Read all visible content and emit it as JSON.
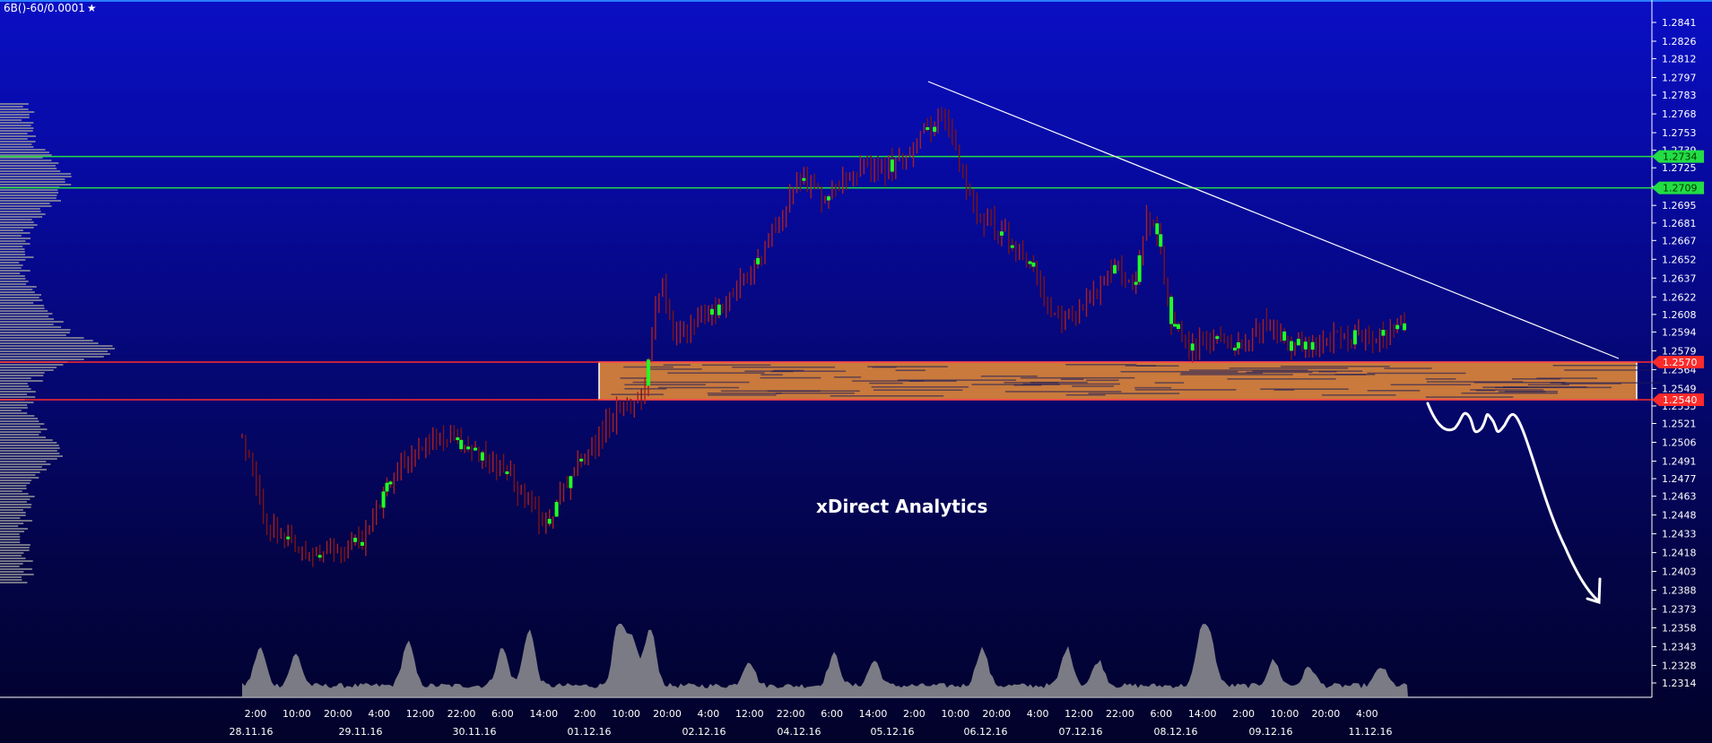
{
  "symbol": "6B()-60/0.0001",
  "symbol_icon": "star-icon",
  "watermark": "xDirect Analytics",
  "colors": {
    "background_top": "#0a0fc4",
    "background_bottom": "#02022a",
    "bar_up": "#22ff22",
    "bar_down": "#8b1a1a",
    "resistance_line": "#22dd44",
    "support_line": "#ff2a2a",
    "zone_fill": "#c97a3c",
    "trendline": "#ffffff",
    "axis_text": "#ffffff"
  },
  "chart_data": {
    "type": "candlestick",
    "instrument": "6B()-60/0.0001",
    "ylim": [
      1.23,
      1.2855
    ],
    "y_ticks": [
      "1.2841",
      "1.2826",
      "1.2812",
      "1.2797",
      "1.2783",
      "1.2768",
      "1.2753",
      "1.2739",
      "1.2725",
      "1.2710",
      "1.2695",
      "1.2681",
      "1.2667",
      "1.2652",
      "1.2637",
      "1.2622",
      "1.2608",
      "1.2594",
      "1.2579",
      "1.2564",
      "1.2549",
      "1.2535",
      "1.2521",
      "1.2506",
      "1.2491",
      "1.2477",
      "1.2463",
      "1.2448",
      "1.2433",
      "1.2418",
      "1.2403",
      "1.2388",
      "1.2373",
      "1.2358",
      "1.2343",
      "1.2328",
      "1.2314"
    ],
    "x_time_labels": [
      "2:00",
      "10:00",
      "20:00",
      "4:00",
      "12:00",
      "22:00",
      "6:00",
      "14:00",
      "2:00",
      "10:00",
      "20:00",
      "4:00",
      "12:00",
      "22:00",
      "6:00",
      "14:00",
      "2:00",
      "10:00",
      "20:00",
      "4:00",
      "12:00",
      "22:00",
      "6:00",
      "14:00",
      "2:00",
      "10:00",
      "20:00",
      "4:00"
    ],
    "x_date_labels": [
      "28.11.16",
      "29.11.16",
      "30.11.16",
      "01.12.16",
      "02.12.16",
      "04.12.16",
      "05.12.16",
      "06.12.16",
      "07.12.16",
      "08.12.16",
      "09.12.16",
      "11.12.16"
    ],
    "price_path": [
      [
        0,
        1.251
      ],
      [
        0.02,
        1.244
      ],
      [
        0.05,
        1.2415
      ],
      [
        0.08,
        1.242
      ],
      [
        0.1,
        1.243
      ],
      [
        0.13,
        1.249
      ],
      [
        0.16,
        1.251
      ],
      [
        0.19,
        1.25
      ],
      [
        0.22,
        1.248
      ],
      [
        0.25,
        1.244
      ],
      [
        0.27,
        1.248
      ],
      [
        0.3,
        1.252
      ],
      [
        0.33,
        1.2545
      ],
      [
        0.345,
        1.264
      ],
      [
        0.355,
        1.259
      ],
      [
        0.37,
        1.26
      ],
      [
        0.39,
        1.261
      ],
      [
        0.42,
        1.264
      ],
      [
        0.445,
        1.269
      ],
      [
        0.46,
        1.272
      ],
      [
        0.48,
        1.27
      ],
      [
        0.5,
        1.2725
      ],
      [
        0.52,
        1.272
      ],
      [
        0.54,
        1.273
      ],
      [
        0.56,
        1.275
      ],
      [
        0.575,
        1.277
      ],
      [
        0.585,
        1.2745
      ],
      [
        0.595,
        1.271
      ],
      [
        0.61,
        1.2685
      ],
      [
        0.63,
        1.267
      ],
      [
        0.65,
        1.265
      ],
      [
        0.665,
        1.2605
      ],
      [
        0.68,
        1.2605
      ],
      [
        0.7,
        1.2625
      ],
      [
        0.72,
        1.2645
      ],
      [
        0.735,
        1.263
      ],
      [
        0.745,
        1.269
      ],
      [
        0.755,
        1.267
      ],
      [
        0.765,
        1.26
      ],
      [
        0.78,
        1.258
      ],
      [
        0.8,
        1.259
      ],
      [
        0.82,
        1.2585
      ],
      [
        0.84,
        1.26
      ],
      [
        0.86,
        1.2585
      ],
      [
        0.88,
        1.258
      ],
      [
        0.9,
        1.259
      ],
      [
        0.93,
        1.259
      ],
      [
        0.96,
        1.2598
      ]
    ],
    "horizontal_levels": [
      {
        "price": 1.2734,
        "label": "1.2734",
        "kind": "resistance",
        "color": "#22dd44"
      },
      {
        "price": 1.2709,
        "label": "1.2709",
        "kind": "resistance",
        "color": "#22dd44"
      },
      {
        "price": 1.257,
        "label": "1.2570",
        "kind": "support",
        "color": "#ff2a2a"
      },
      {
        "price": 1.254,
        "label": "1.2540",
        "kind": "support",
        "color": "#ff2a2a"
      }
    ],
    "support_zone": {
      "from_price": 1.254,
      "to_price": 1.257,
      "starts_at": "01.12.16 2:00"
    },
    "trendline": {
      "from": {
        "time": "05.12.16 ~22:00",
        "price": 1.279
      },
      "to": {
        "time": "11.12.16 (right edge)",
        "price": 1.2575
      }
    },
    "projection": "hand-drawn arrow pointing down from 1.2540 toward 1.2380",
    "volume_profile": "left side horizontal histogram",
    "volume_area": "grey area at bottom",
    "grid": false,
    "legend": "none"
  }
}
